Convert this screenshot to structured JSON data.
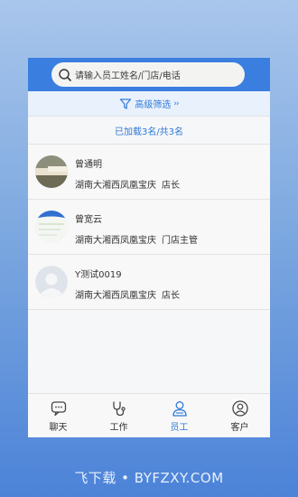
{
  "search": {
    "placeholder": "请输入员工姓名/门店/电话"
  },
  "filter": {
    "label": "高级筛选",
    "chevron": "››"
  },
  "status": {
    "loaded": "已加载3名/共3名"
  },
  "employees": [
    {
      "name": "曾通明",
      "store": "湖南大湘西凤凰宝庆",
      "role": "店长"
    },
    {
      "name": "曾宽云",
      "store": "湖南大湘西凤凰宝庆",
      "role": "门店主管"
    },
    {
      "name": "Y测试0019",
      "store": "湖南大湘西凤凰宝庆",
      "role": "店长"
    }
  ],
  "tabs": [
    {
      "label": "聊天",
      "icon": "chat-icon"
    },
    {
      "label": "工作",
      "icon": "stethoscope-icon"
    },
    {
      "label": "员工",
      "icon": "staff-icon",
      "active": true
    },
    {
      "label": "客户",
      "icon": "customer-icon"
    }
  ],
  "colors": {
    "accent": "#2f79d8",
    "topbar": "#3a7ee0"
  },
  "watermark": "飞下载 • BYFZXY.COM"
}
